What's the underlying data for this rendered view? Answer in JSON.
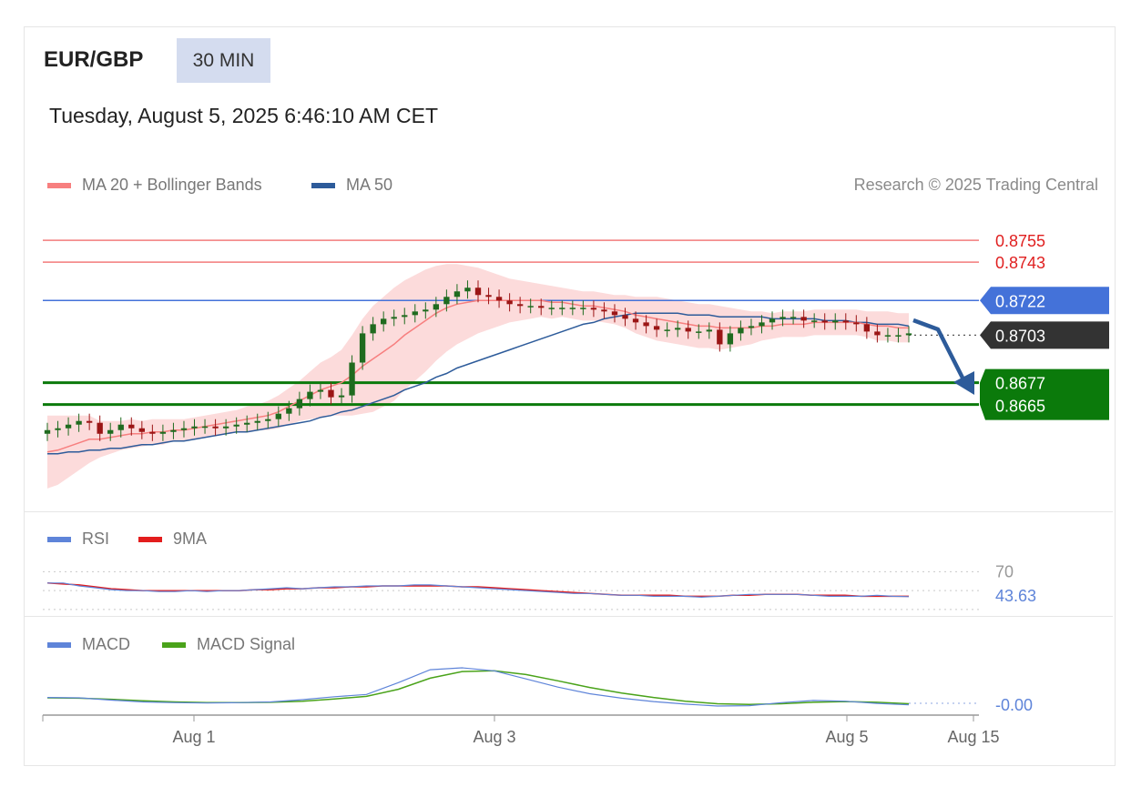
{
  "header": {
    "symbol": "EUR/GBP",
    "timeframe": "30 MIN",
    "datetime": "Tuesday, August 5, 2025 6:46:10 AM CET",
    "credit": "Research © 2025 Trading Central"
  },
  "legends": {
    "ma20": "MA 20 + Bollinger Bands",
    "ma50": "MA 50",
    "rsi": "RSI",
    "rsi_ma": "9MA",
    "macd": "MACD",
    "macd_signal": "MACD Signal"
  },
  "colors": {
    "ma20": "#f77f7f",
    "ma50": "#2d5b9a",
    "resistance": "#f27b7b",
    "pivot": "#4472d9",
    "support": "#0b7a0b",
    "last": "#333333",
    "candle_up": "#1f6b1f",
    "candle_down": "#9b1515",
    "rsi": "#5e84d9",
    "rsi_ma": "#e31d1d",
    "macd": "#5e84d9",
    "macd_signal": "#4aa31a"
  },
  "chart_data": [
    {
      "type": "candlestick",
      "title": "EUR/GBP 30 MIN",
      "x_ticks": [
        "Aug 1",
        "Aug 3",
        "Aug 5",
        "Aug 15"
      ],
      "ylim": [
        0.861,
        0.8768
      ],
      "levels": [
        {
          "label": "0.8755",
          "value": 0.8755,
          "kind": "resistance"
        },
        {
          "label": "0.8743",
          "value": 0.8743,
          "kind": "resistance"
        },
        {
          "label": "0.8722",
          "value": 0.8722,
          "kind": "pivot"
        },
        {
          "label": "0.8677",
          "value": 0.8677,
          "kind": "support"
        },
        {
          "label": "0.8665",
          "value": 0.8665,
          "kind": "support"
        }
      ],
      "last_price": {
        "label": "0.8703",
        "value": 0.8703
      },
      "close": [
        0.8651,
        0.8652,
        0.8654,
        0.8656,
        0.8655,
        0.8649,
        0.8651,
        0.8654,
        0.8652,
        0.865,
        0.8649,
        0.865,
        0.8651,
        0.8652,
        0.8653,
        0.8653,
        0.8652,
        0.8653,
        0.8654,
        0.8655,
        0.8656,
        0.8657,
        0.866,
        0.8663,
        0.8668,
        0.8672,
        0.8673,
        0.8669,
        0.867,
        0.8688,
        0.8704,
        0.8709,
        0.8712,
        0.8713,
        0.8714,
        0.8716,
        0.8717,
        0.872,
        0.8724,
        0.8727,
        0.8729,
        0.8725,
        0.8724,
        0.8722,
        0.872,
        0.8719,
        0.8719,
        0.8718,
        0.8718,
        0.8718,
        0.8718,
        0.8718,
        0.8717,
        0.8716,
        0.8714,
        0.8712,
        0.871,
        0.8708,
        0.8706,
        0.8706,
        0.8707,
        0.8705,
        0.8705,
        0.8706,
        0.8698,
        0.8704,
        0.8707,
        0.8708,
        0.871,
        0.8712,
        0.8713,
        0.8713,
        0.8711,
        0.8711,
        0.871,
        0.8711,
        0.871,
        0.8709,
        0.8705,
        0.8703,
        0.8703,
        0.8703,
        0.8704
      ],
      "series": [
        {
          "name": "MA 20 + Bollinger Bands",
          "values": [
            0.8639,
            0.864,
            0.8642,
            0.8644,
            0.8646,
            0.8646,
            0.8647,
            0.8648,
            0.8649,
            0.8649,
            0.865,
            0.865,
            0.8651,
            0.8651,
            0.8652,
            0.8653,
            0.8654,
            0.8655,
            0.8656,
            0.8657,
            0.8658,
            0.8659,
            0.8661,
            0.8664,
            0.8667,
            0.867,
            0.8673,
            0.8675,
            0.8677,
            0.8681,
            0.8686,
            0.869,
            0.8694,
            0.8698,
            0.8703,
            0.8707,
            0.8711,
            0.8715,
            0.8718,
            0.872,
            0.8721,
            0.8722,
            0.8722,
            0.8722,
            0.8722,
            0.8722,
            0.8722,
            0.8722,
            0.8721,
            0.8721,
            0.872,
            0.8719,
            0.8719,
            0.8718,
            0.8717,
            0.8716,
            0.8714,
            0.8713,
            0.8712,
            0.8711,
            0.871,
            0.8709,
            0.8708,
            0.8708,
            0.8707,
            0.8707,
            0.8707,
            0.8707,
            0.8708,
            0.8708,
            0.8709,
            0.8709,
            0.8709,
            0.871,
            0.871,
            0.871,
            0.871,
            0.871,
            0.8709,
            0.8708,
            0.8708,
            0.8707,
            0.8707
          ]
        },
        {
          "name": "MA 50",
          "values": [
            0.8638,
            0.8638,
            0.8639,
            0.8639,
            0.864,
            0.864,
            0.8641,
            0.8641,
            0.8642,
            0.8643,
            0.8643,
            0.8644,
            0.8645,
            0.8645,
            0.8646,
            0.8647,
            0.8648,
            0.8649,
            0.865,
            0.865,
            0.8651,
            0.8652,
            0.8653,
            0.8654,
            0.8655,
            0.8656,
            0.8658,
            0.8659,
            0.8661,
            0.8662,
            0.8664,
            0.8666,
            0.8668,
            0.867,
            0.8673,
            0.8675,
            0.8677,
            0.868,
            0.8682,
            0.8685,
            0.8687,
            0.8689,
            0.8691,
            0.8693,
            0.8695,
            0.8697,
            0.8699,
            0.8701,
            0.8703,
            0.8705,
            0.8707,
            0.8709,
            0.871,
            0.8712,
            0.8713,
            0.8714,
            0.8715,
            0.8715,
            0.8715,
            0.8715,
            0.8715,
            0.8714,
            0.8714,
            0.8714,
            0.8713,
            0.8713,
            0.8713,
            0.8713,
            0.8713,
            0.8712,
            0.8712,
            0.8712,
            0.8712,
            0.8712,
            0.8711,
            0.8711,
            0.8711,
            0.871,
            0.871,
            0.8709,
            0.8709,
            0.8709,
            0.8708
          ]
        }
      ],
      "bollinger_halfwidth": [
        0.002,
        0.0019,
        0.0017,
        0.0015,
        0.0013,
        0.001,
        0.0009,
        0.0008,
        0.0008,
        0.0007,
        0.0007,
        0.0007,
        0.0006,
        0.0006,
        0.0006,
        0.0006,
        0.0006,
        0.0006,
        0.0006,
        0.0007,
        0.0007,
        0.0008,
        0.0009,
        0.001,
        0.0011,
        0.0013,
        0.0015,
        0.0016,
        0.0018,
        0.0022,
        0.0026,
        0.0029,
        0.003,
        0.0031,
        0.003,
        0.0029,
        0.0028,
        0.0026,
        0.0024,
        0.0022,
        0.002,
        0.0018,
        0.0016,
        0.0014,
        0.0012,
        0.0011,
        0.001,
        0.0009,
        0.0009,
        0.0008,
        0.0008,
        0.0008,
        0.0008,
        0.0008,
        0.0008,
        0.0009,
        0.001,
        0.0011,
        0.0012,
        0.0012,
        0.0012,
        0.0012,
        0.0012,
        0.0012,
        0.0012,
        0.0011,
        0.001,
        0.0009,
        0.0008,
        0.0007,
        0.0007,
        0.0007,
        0.0007,
        0.0007,
        0.0007,
        0.0007,
        0.0007,
        0.0007,
        0.0007,
        0.0008,
        0.0008,
        0.0008,
        0.0008
      ],
      "annotation": "Projected move down toward 0.8677 / 0.8665"
    },
    {
      "type": "line",
      "title": "RSI",
      "ylim": [
        28,
        80
      ],
      "reference": {
        "label": "70",
        "value": 70
      },
      "last_label": "43.63",
      "series": [
        {
          "name": "RSI",
          "values": [
            58,
            58,
            55,
            53,
            51,
            50,
            50,
            49,
            49,
            50,
            49,
            50,
            50,
            51,
            52,
            53,
            52,
            53,
            54,
            54,
            55,
            55,
            55,
            56,
            56,
            55,
            54,
            53,
            52,
            51,
            50,
            49,
            48,
            47,
            47,
            46,
            45,
            45,
            44,
            44,
            44,
            43,
            44,
            45,
            46,
            46,
            46,
            46,
            45,
            44,
            44,
            44,
            45,
            44,
            43.63
          ]
        },
        {
          "name": "9MA",
          "values": [
            58,
            57,
            56,
            54,
            52,
            51,
            50,
            50,
            50,
            50,
            50,
            50,
            50,
            51,
            51,
            52,
            52,
            53,
            53,
            54,
            54,
            55,
            55,
            55,
            55,
            55,
            54,
            54,
            53,
            52,
            51,
            50,
            49,
            48,
            47,
            46,
            45,
            45,
            45,
            45,
            44,
            44,
            44,
            45,
            45,
            46,
            46,
            46,
            45,
            45,
            45,
            44,
            44,
            44,
            44
          ]
        }
      ]
    },
    {
      "type": "line",
      "title": "MACD",
      "last_label": "-0.00",
      "series": [
        {
          "name": "MACD",
          "values": [
            0.2,
            0.19,
            0.13,
            0.08,
            0.06,
            0.05,
            0.06,
            0.08,
            0.14,
            0.22,
            0.28,
            0.6,
            0.95,
            1.0,
            0.92,
            0.7,
            0.48,
            0.3,
            0.18,
            0.09,
            0.02,
            -0.03,
            -0.02,
            0.06,
            0.12,
            0.1,
            0.04,
            0.0
          ]
        },
        {
          "name": "MACD Signal",
          "values": [
            0.19,
            0.18,
            0.15,
            0.11,
            0.08,
            0.06,
            0.06,
            0.07,
            0.1,
            0.16,
            0.23,
            0.42,
            0.72,
            0.9,
            0.92,
            0.82,
            0.65,
            0.47,
            0.32,
            0.2,
            0.1,
            0.03,
            0.01,
            0.03,
            0.07,
            0.09,
            0.07,
            0.03
          ]
        }
      ]
    }
  ]
}
